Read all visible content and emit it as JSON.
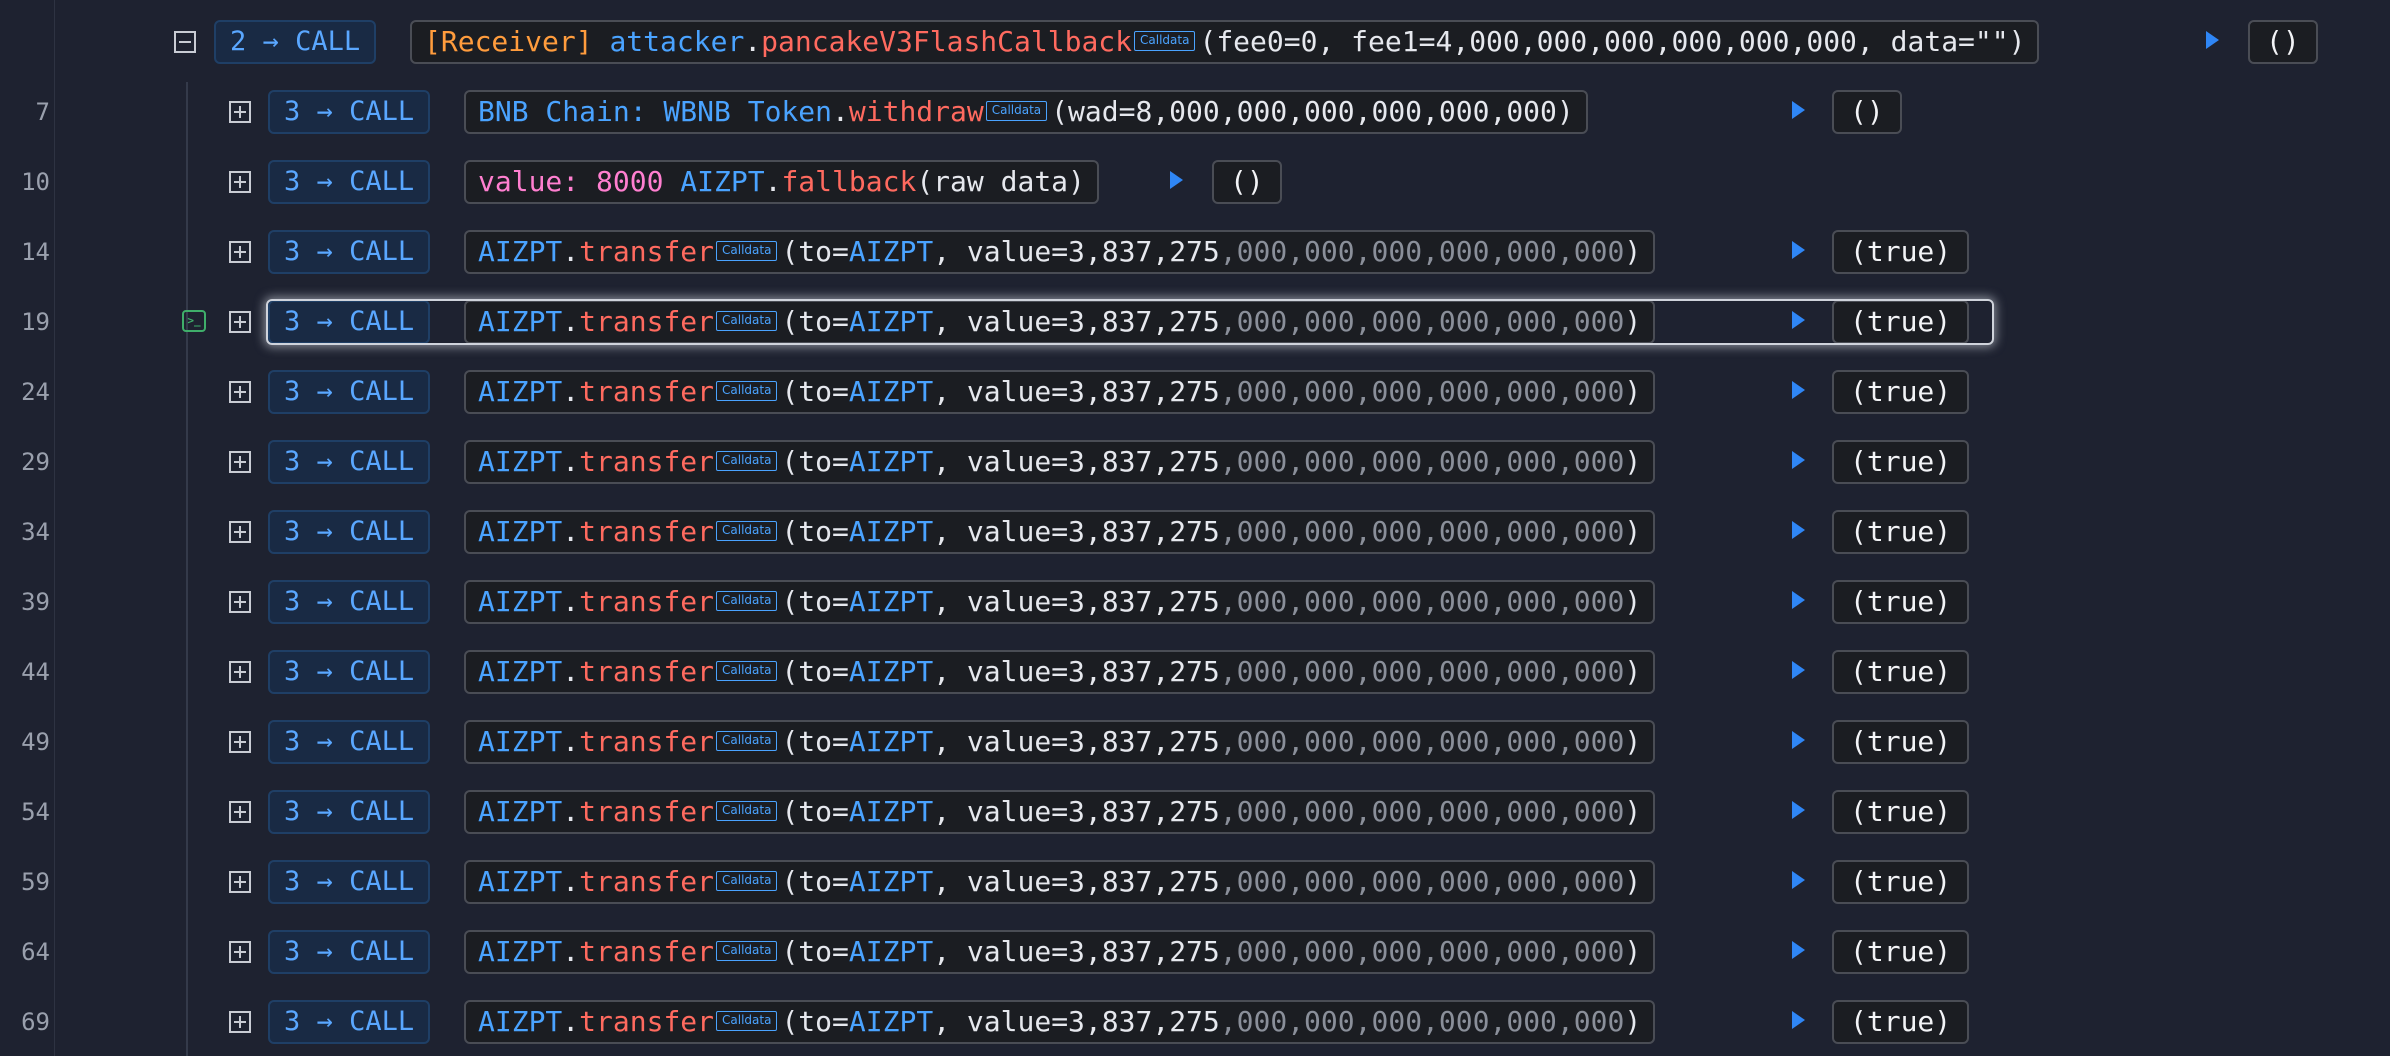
{
  "rows": [
    {
      "line": "",
      "depth": "2",
      "kind": "CALL",
      "receiver": "[Receiver]",
      "contract": "attacker",
      "fn": "pancakeV3FlashCallback",
      "badge": "Calldata",
      "args": "(fee0=0, fee1=4,000,000,000,000,000,000, data=\"\")",
      "ret": "()"
    },
    {
      "line": "7",
      "depth": "3",
      "kind": "CALL",
      "contract": "BNB Chain: WBNB Token",
      "fn": "withdraw",
      "badge": "Calldata",
      "args": "(wad=8,000,000,000,000,000,000)",
      "ret": "()"
    },
    {
      "line": "10",
      "depth": "3",
      "kind": "CALL",
      "value_label": "value: 8000",
      "contract": "AIZPT",
      "fn": "fallback",
      "args": "(raw data)",
      "ret": "()"
    },
    {
      "line": "14",
      "depth": "3",
      "kind": "CALL",
      "contract": "AIZPT",
      "fn": "transfer",
      "badge": "Calldata",
      "to": "AIZPT",
      "value_main": "3,837,275",
      "value_tail": ",000,000,000,000,000,000",
      "ret": "(true)"
    },
    {
      "line": "19",
      "depth": "3",
      "kind": "CALL",
      "contract": "AIZPT",
      "fn": "transfer",
      "badge": "Calldata",
      "to": "AIZPT",
      "value_main": "3,837,275",
      "value_tail": ",000,000,000,000,000,000",
      "ret": "(true)"
    },
    {
      "line": "24",
      "depth": "3",
      "kind": "CALL",
      "contract": "AIZPT",
      "fn": "transfer",
      "badge": "Calldata",
      "to": "AIZPT",
      "value_main": "3,837,275",
      "value_tail": ",000,000,000,000,000,000",
      "ret": "(true)"
    },
    {
      "line": "29",
      "depth": "3",
      "kind": "CALL",
      "contract": "AIZPT",
      "fn": "transfer",
      "badge": "Calldata",
      "to": "AIZPT",
      "value_main": "3,837,275",
      "value_tail": ",000,000,000,000,000,000",
      "ret": "(true)"
    },
    {
      "line": "34",
      "depth": "3",
      "kind": "CALL",
      "contract": "AIZPT",
      "fn": "transfer",
      "badge": "Calldata",
      "to": "AIZPT",
      "value_main": "3,837,275",
      "value_tail": ",000,000,000,000,000,000",
      "ret": "(true)"
    },
    {
      "line": "39",
      "depth": "3",
      "kind": "CALL",
      "contract": "AIZPT",
      "fn": "transfer",
      "badge": "Calldata",
      "to": "AIZPT",
      "value_main": "3,837,275",
      "value_tail": ",000,000,000,000,000,000",
      "ret": "(true)"
    },
    {
      "line": "44",
      "depth": "3",
      "kind": "CALL",
      "contract": "AIZPT",
      "fn": "transfer",
      "badge": "Calldata",
      "to": "AIZPT",
      "value_main": "3,837,275",
      "value_tail": ",000,000,000,000,000,000",
      "ret": "(true)"
    },
    {
      "line": "49",
      "depth": "3",
      "kind": "CALL",
      "contract": "AIZPT",
      "fn": "transfer",
      "badge": "Calldata",
      "to": "AIZPT",
      "value_main": "3,837,275",
      "value_tail": ",000,000,000,000,000,000",
      "ret": "(true)"
    },
    {
      "line": "54",
      "depth": "3",
      "kind": "CALL",
      "contract": "AIZPT",
      "fn": "transfer",
      "badge": "Calldata",
      "to": "AIZPT",
      "value_main": "3,837,275",
      "value_tail": ",000,000,000,000,000,000",
      "ret": "(true)"
    },
    {
      "line": "59",
      "depth": "3",
      "kind": "CALL",
      "contract": "AIZPT",
      "fn": "transfer",
      "badge": "Calldata",
      "to": "AIZPT",
      "value_main": "3,837,275",
      "value_tail": ",000,000,000,000,000,000",
      "ret": "(true)"
    },
    {
      "line": "64",
      "depth": "3",
      "kind": "CALL",
      "contract": "AIZPT",
      "fn": "transfer",
      "badge": "Calldata",
      "to": "AIZPT",
      "value_main": "3,837,275",
      "value_tail": ",000,000,000,000,000,000",
      "ret": "(true)"
    },
    {
      "line": "69",
      "depth": "3",
      "kind": "CALL",
      "contract": "AIZPT",
      "fn": "transfer",
      "badge": "Calldata",
      "to": "AIZPT",
      "value_main": "3,837,275",
      "value_tail": ",000,000,000,000,000,000",
      "ret": "(true)"
    }
  ],
  "arrow_glyph": "→",
  "colors": {
    "background": "#1e2230",
    "contract": "#4aa3ff",
    "function": "#ff6a5f",
    "receiver": "#ff9c3d",
    "value": "#ff7fd0",
    "call_badge": "#5aa7ff",
    "play": "#2f86f5",
    "terminal_icon": "#3fae6a"
  },
  "selected_line": "19"
}
